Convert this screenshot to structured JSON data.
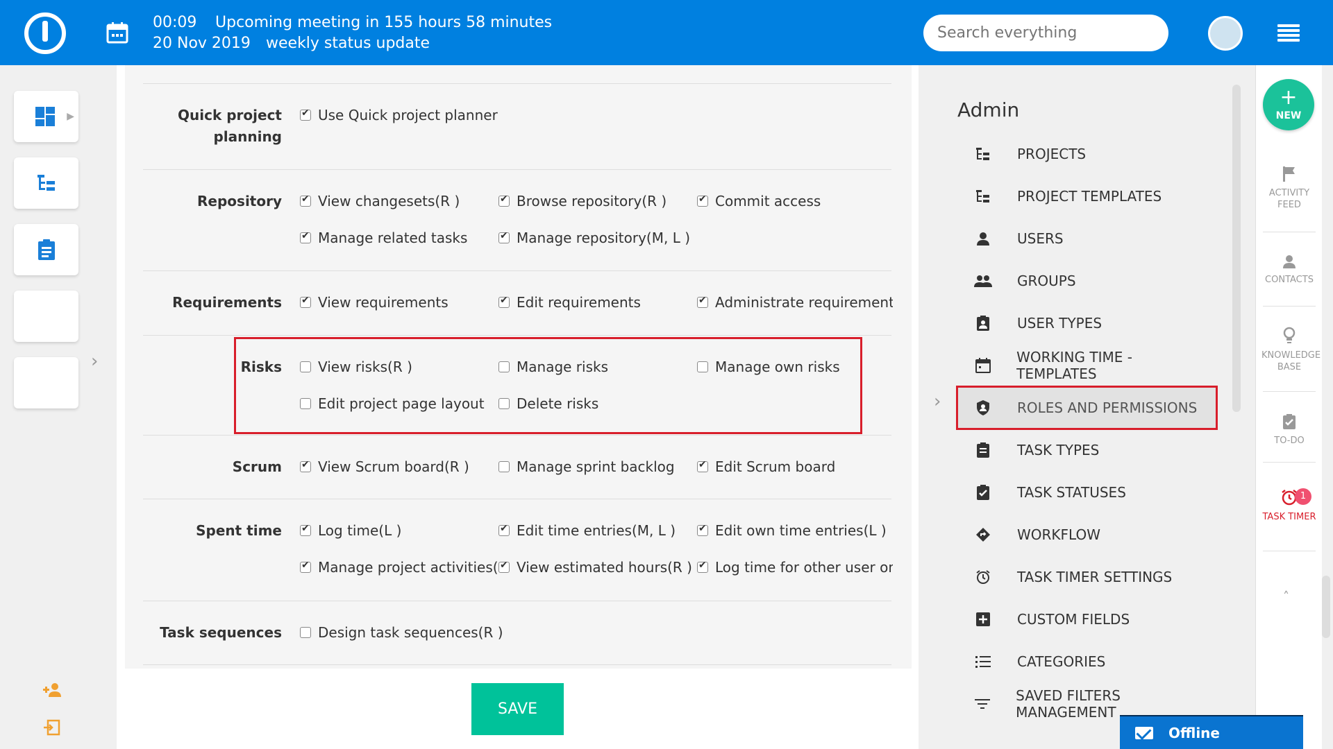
{
  "topbar": {
    "meeting_time": "00:09",
    "meeting_text": "Upcoming meeting in 155 hours 58 minutes",
    "meeting_date": "20 Nov 2019",
    "meeting_name": "weekly status update",
    "search_placeholder": "Search everything"
  },
  "form": {
    "sections": [
      {
        "label": "Quick project planning",
        "perms": [
          {
            "label": "Use Quick project planner",
            "checked": true
          }
        ]
      },
      {
        "label": "Repository",
        "perms": [
          {
            "label": "View changesets(R )",
            "checked": true
          },
          {
            "label": "Browse repository(R )",
            "checked": true
          },
          {
            "label": "Commit access",
            "checked": true
          },
          {
            "label": "Manage related tasks",
            "checked": true
          },
          {
            "label": "Manage repository(M, L )",
            "checked": true
          }
        ]
      },
      {
        "label": "Requirements",
        "perms": [
          {
            "label": "View requirements",
            "checked": true
          },
          {
            "label": "Edit requirements",
            "checked": true
          },
          {
            "label": "Administrate requirements",
            "checked": true
          }
        ]
      },
      {
        "label": "Risks",
        "perms": [
          {
            "label": "View risks(R )",
            "checked": false
          },
          {
            "label": "Manage risks",
            "checked": false
          },
          {
            "label": "Manage own risks",
            "checked": false
          },
          {
            "label": "Edit project page layout",
            "checked": false
          },
          {
            "label": "Delete risks",
            "checked": false
          }
        ]
      },
      {
        "label": "Scrum",
        "perms": [
          {
            "label": "View Scrum board(R )",
            "checked": true
          },
          {
            "label": "Manage sprint backlog",
            "checked": false
          },
          {
            "label": "Edit Scrum board",
            "checked": true
          }
        ]
      },
      {
        "label": "Spent time",
        "perms": [
          {
            "label": "Log time(L )",
            "checked": true
          },
          {
            "label": "Edit time entries(M, L )",
            "checked": true
          },
          {
            "label": "Edit own time entries(L )",
            "checked": true
          },
          {
            "label": "Manage project activities(M",
            "checked": true
          },
          {
            "label": "View estimated hours(R )",
            "checked": true
          },
          {
            "label": "Log time for other user on :",
            "checked": true
          }
        ]
      },
      {
        "label": "Task sequences",
        "perms": [
          {
            "label": "Design task sequences(R )",
            "checked": false
          }
        ]
      }
    ],
    "save_label": "SAVE"
  },
  "admin": {
    "title": "Admin",
    "items": [
      {
        "label": "PROJECTS",
        "icon": "project-tree-icon"
      },
      {
        "label": "PROJECT TEMPLATES",
        "icon": "project-tree-icon"
      },
      {
        "label": "USERS",
        "icon": "user-icon"
      },
      {
        "label": "GROUPS",
        "icon": "group-icon"
      },
      {
        "label": "USER TYPES",
        "icon": "badge-icon"
      },
      {
        "label": "WORKING TIME - TEMPLATES",
        "icon": "calendar-icon"
      },
      {
        "label": "ROLES AND PERMISSIONS",
        "icon": "shield-icon"
      },
      {
        "label": "TASK TYPES",
        "icon": "clipboard-icon"
      },
      {
        "label": "TASK STATUSES",
        "icon": "clipboard-check-icon"
      },
      {
        "label": "WORKFLOW",
        "icon": "workflow-icon"
      },
      {
        "label": "TASK TIMER SETTINGS",
        "icon": "alarm-icon"
      },
      {
        "label": "CUSTOM FIELDS",
        "icon": "plus-box-icon"
      },
      {
        "label": "CATEGORIES",
        "icon": "list-icon"
      },
      {
        "label": "SAVED FILTERS MANAGEMENT",
        "icon": "filter-icon"
      }
    ]
  },
  "rightrail": {
    "new_label": "NEW",
    "items": [
      {
        "label": "ACTIVITY FEED"
      },
      {
        "label": "CONTACTS"
      },
      {
        "label": "KNOWLEDGE BASE"
      },
      {
        "label": "TO-DO"
      },
      {
        "label": "TASK TIMER"
      }
    ],
    "task_timer_badge": "1"
  },
  "chat": {
    "status": "Offline"
  },
  "colors": {
    "topbar": "#0080e0",
    "accent_green": "#00c29a",
    "highlight_red": "#d81e2b",
    "timer_red": "#d81e2b"
  }
}
